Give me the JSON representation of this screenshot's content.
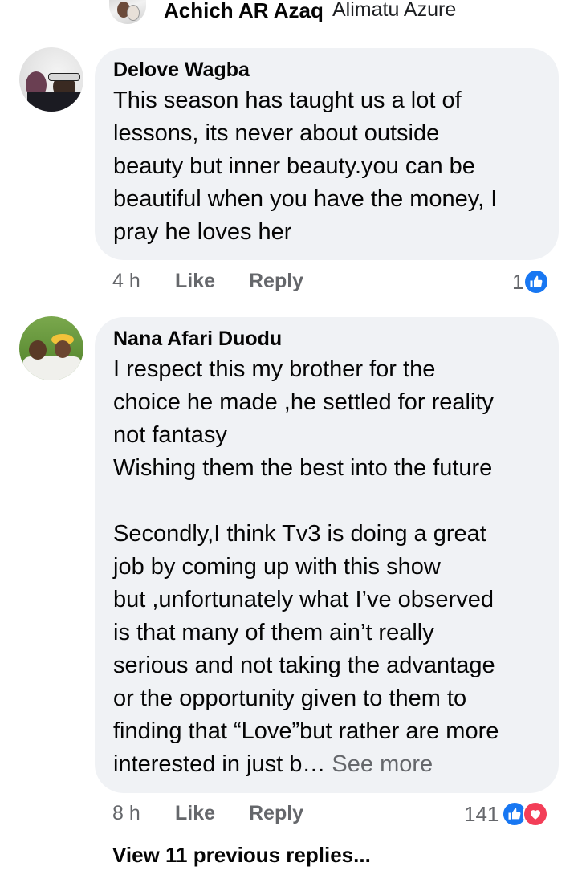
{
  "top_reply": {
    "author": "Achich AR Azaq",
    "tagged": "Alimatu Azure"
  },
  "comments": [
    {
      "author": "Delove Wagba",
      "text": "This season has taught us a lot of\nlessons, its never about outside\nbeauty but inner beauty.you can be\nbeautiful when you have the money, I\npray he loves her",
      "time": "4 h",
      "like_label": "Like",
      "reply_label": "Reply",
      "reaction_count": "1"
    },
    {
      "author": "Nana Afari Duodu",
      "text": "I respect this my brother for the\nchoice he made ,he settled for reality\nnot fantasy\nWishing them the best into the future\n\nSecondly,I think Tv3 is doing a great\njob by coming up with this show\nbut ,unfortunately what I’ve observed\nis that many of them ain’t really\nserious and not taking the advantage\nor the opportunity given to them to\nfinding that “Love”but rather are more\ninterested in just b… ",
      "see_more": "See more",
      "time": "8 h",
      "like_label": "Like",
      "reply_label": "Reply",
      "reaction_count": "141"
    }
  ],
  "view_previous_replies": "View 11 previous replies...",
  "colors": {
    "bubble_bg": "#f0f2f5",
    "secondary_text": "#65676b",
    "like_blue": "#1877f2",
    "love_red": "#f33e58"
  },
  "icons": {
    "like_reaction": "thumbs-up-icon",
    "love_reaction": "heart-icon"
  }
}
